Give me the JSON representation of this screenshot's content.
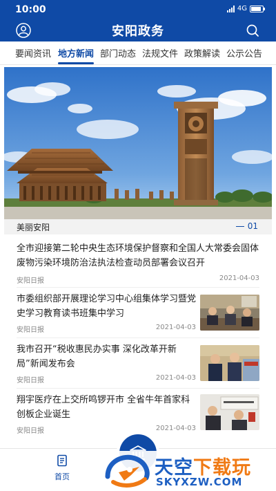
{
  "status": {
    "time": "10:00",
    "network": "4G"
  },
  "header": {
    "title": "安阳政务"
  },
  "tabs": [
    "要闻资讯",
    "地方新闻",
    "部门动态",
    "法规文件",
    "政策解读",
    "公示公告"
  ],
  "active_tab": "地方新闻",
  "banner": {
    "caption": "美丽安阳",
    "index": "01"
  },
  "news": [
    {
      "title": "全市迎接第二轮中央生态环境保护督察和全国人大常委会固体废物污染环境防治法执法检查动员部署会议召开",
      "source": "安阳日报",
      "date": "2021-04-03"
    },
    {
      "title": "市委组织部开展理论学习中心组集体学习暨党史学习教育读书班集中学习",
      "source": "安阳日报",
      "date": "2021-04-03"
    },
    {
      "title": "我市召开“税收惠民办实事 深化改革开新局”新闻发布会",
      "source": "安阳日报",
      "date": "2021-04-03"
    },
    {
      "title": "翔宇医疗在上交所鸣锣开市 全省牛年首家科创板企业诞生",
      "source": "安阳日报",
      "date": "2021-04-03"
    }
  ],
  "bottom_nav": {
    "home_label": "首页"
  },
  "watermark": {
    "line1_a": "天空",
    "line1_b": "下载玩",
    "line2": "SKYXZW.COM"
  },
  "colors": {
    "primary": "#0f4aa6",
    "accent": "#f07a14"
  }
}
